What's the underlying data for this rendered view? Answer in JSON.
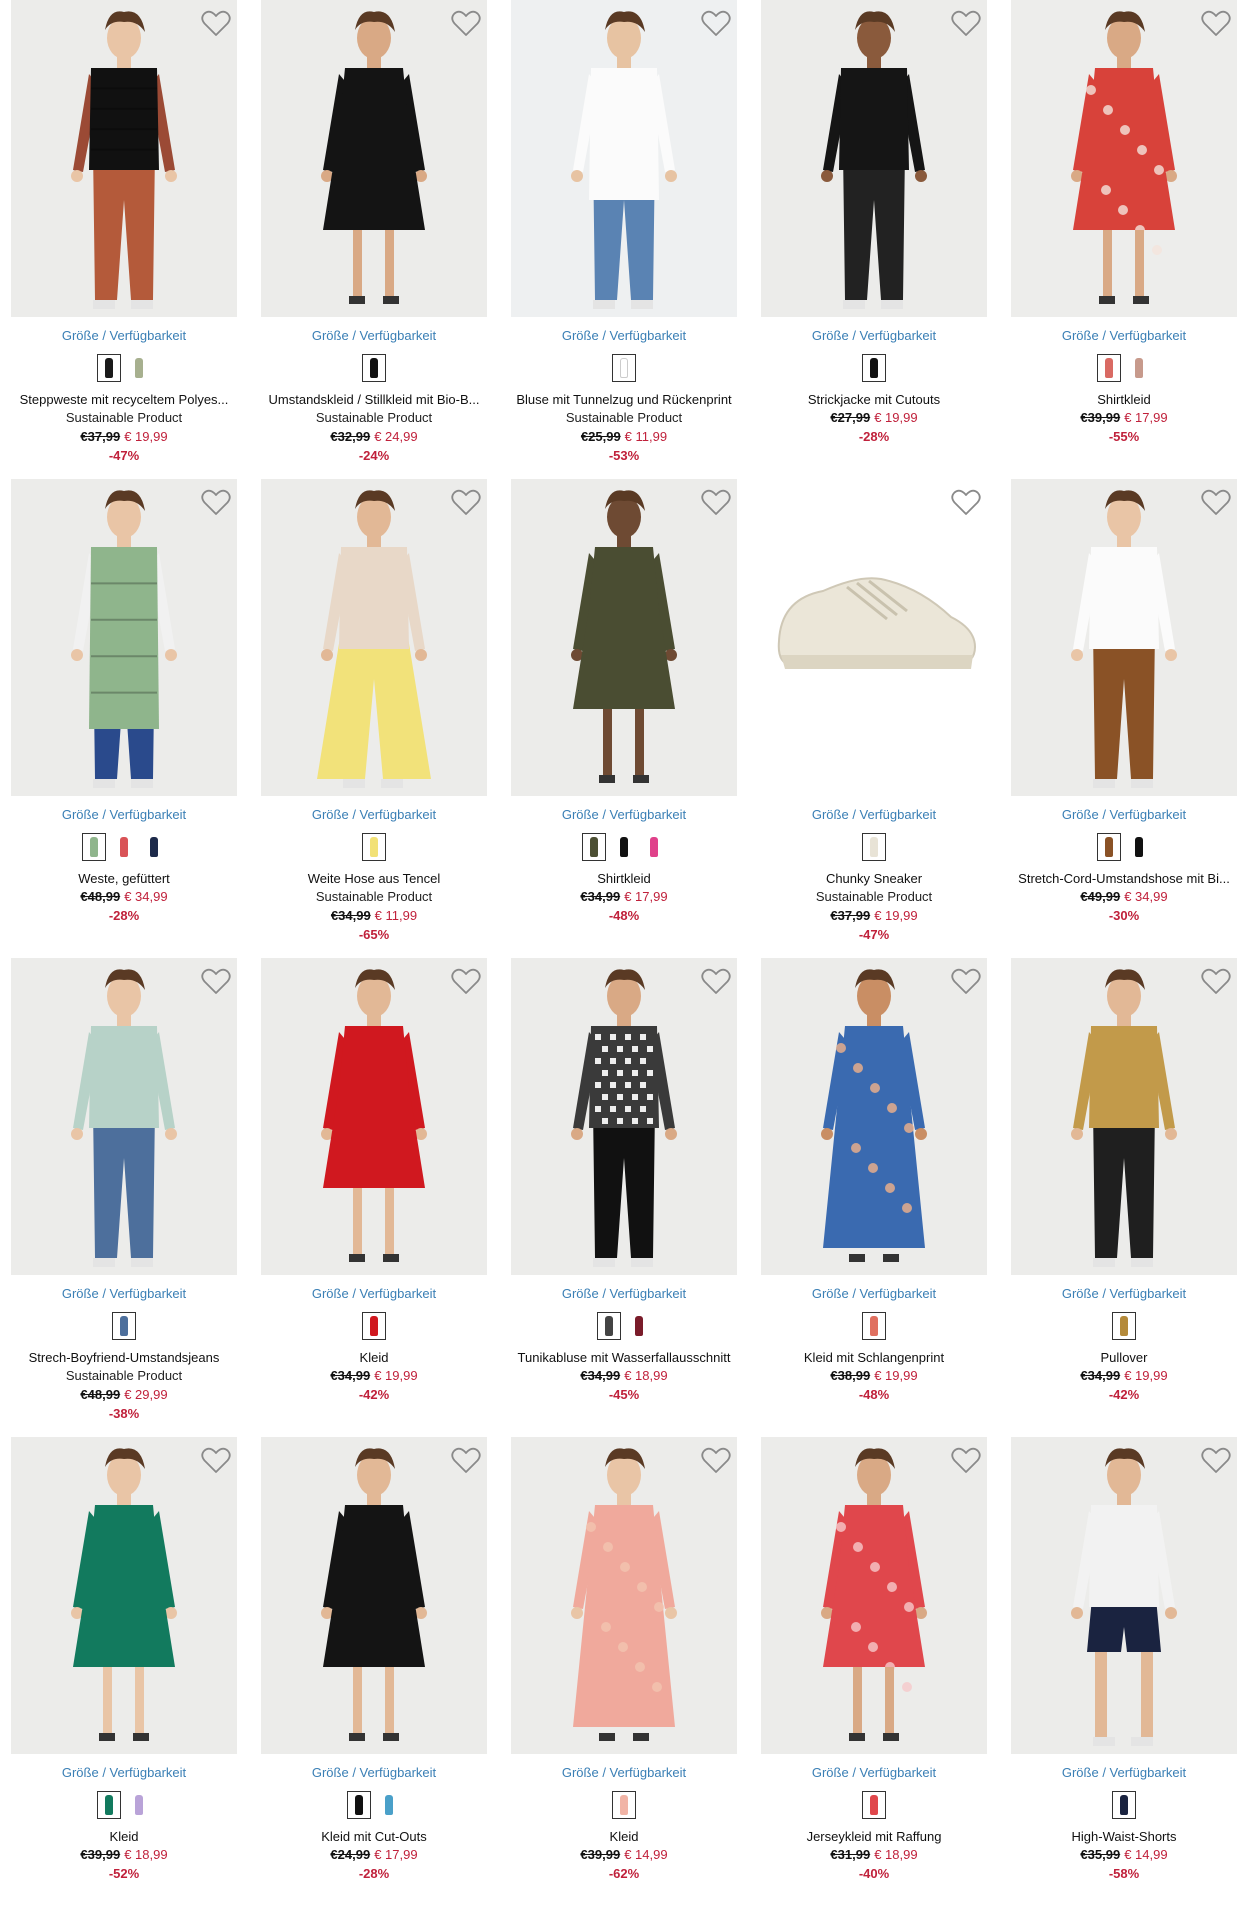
{
  "link_label": "Größe / Verfügbarkeit",
  "sustainable_label": "Sustainable Product",
  "products": [
    {
      "title": "Steppweste mit recyceltem Polyes...",
      "sub": "Sustainable Product",
      "old": "€37,99",
      "new": "€ 19,99",
      "disc": "-47%",
      "swatches": [
        "#1a1a1a",
        "#a7b08f"
      ],
      "look": "vest-black",
      "skin": "#e9c5a6",
      "bg": "#ececea"
    },
    {
      "title": "Umstandskleid / Stillkleid mit Bio-B...",
      "sub": "Sustainable Product",
      "old": "€32,99",
      "new": "€ 24,99",
      "disc": "-24%",
      "swatches": [
        "#111111"
      ],
      "look": "dress-black",
      "skin": "#d9a985",
      "bg": "#ececea"
    },
    {
      "title": "Bluse mit Tunnelzug und Rückenprint",
      "sub": "Sustainable Product",
      "old": "€25,99",
      "new": "€ 11,99",
      "disc": "-53%",
      "swatches": [
        "#ffffff"
      ],
      "look": "blouse-white",
      "skin": "#e7c3a2",
      "bg": "#eef0f1"
    },
    {
      "title": "Strickjacke mit Cutouts",
      "sub": "",
      "old": "€27,99",
      "new": "€ 19,99",
      "disc": "-28%",
      "swatches": [
        "#111111"
      ],
      "look": "cardigan-black",
      "skin": "#8a5a3c",
      "bg": "#ececea"
    },
    {
      "title": "Shirtkleid",
      "sub": "",
      "old": "€39,99",
      "new": "€ 17,99",
      "disc": "-55%",
      "swatches": [
        "#d96a63",
        "#c79a8c"
      ],
      "look": "dress-floral",
      "skin": "#d9a985",
      "bg": "#ededeb"
    },
    {
      "title": "Weste, gefüttert",
      "sub": "",
      "old": "€48,99",
      "new": "€ 34,99",
      "disc": "-28%",
      "swatches": [
        "#8fb58c",
        "#d95357",
        "#1d2a4a"
      ],
      "look": "vest-green",
      "skin": "#e9c5a6",
      "bg": "#ececea"
    },
    {
      "title": "Weite Hose aus Tencel",
      "sub": "Sustainable Product",
      "old": "€34,99",
      "new": "€ 11,99",
      "disc": "-65%",
      "swatches": [
        "#f2e176"
      ],
      "look": "pants-yellow",
      "skin": "#e2b896",
      "bg": "#ececea"
    },
    {
      "title": "Shirtkleid",
      "sub": "",
      "old": "€34,99",
      "new": "€ 17,99",
      "disc": "-48%",
      "swatches": [
        "#4c4f33",
        "#111111",
        "#e0418a"
      ],
      "look": "dress-olive",
      "skin": "#6e4a33",
      "bg": "#ececea"
    },
    {
      "title": "Chunky Sneaker",
      "sub": "Sustainable Product",
      "old": "€37,99",
      "new": "€ 19,99",
      "disc": "-47%",
      "swatches": [
        "#e8e3d6"
      ],
      "look": "sneaker",
      "skin": "#e8e3d6",
      "bg": "#ffffff"
    },
    {
      "title": "Stretch-Cord-Umstandshose mit Bi...",
      "sub": "",
      "old": "€49,99",
      "new": "€ 34,99",
      "disc": "-30%",
      "swatches": [
        "#8a5226",
        "#111111"
      ],
      "look": "pants-brown",
      "skin": "#e9c5a6",
      "bg": "#ececea"
    },
    {
      "title": "Strech-Boyfriend-Umstandsjeans",
      "sub": "Sustainable Product",
      "old": "€48,99",
      "new": "€ 29,99",
      "disc": "-38%",
      "swatches": [
        "#4d6f9c"
      ],
      "look": "jeans",
      "skin": "#e9c5a6",
      "bg": "#ececea"
    },
    {
      "title": "Kleid",
      "sub": "",
      "old": "€34,99",
      "new": "€ 19,99",
      "disc": "-42%",
      "swatches": [
        "#d0181f"
      ],
      "look": "dress-red",
      "skin": "#e2b896",
      "bg": "#ececea"
    },
    {
      "title": "Tunikabluse mit Wasserfallausschnitt",
      "sub": "",
      "old": "€34,99",
      "new": "€ 18,99",
      "disc": "-45%",
      "swatches": [
        "#444444",
        "#7a1c2a"
      ],
      "look": "blouse-pattern",
      "skin": "#d9a985",
      "bg": "#ececea"
    },
    {
      "title": "Kleid mit Schlangenprint",
      "sub": "",
      "old": "€38,99",
      "new": "€ 19,99",
      "disc": "-48%",
      "swatches": [
        "#e07060"
      ],
      "look": "dress-maxi",
      "skin": "#c98e64",
      "bg": "#ececea"
    },
    {
      "title": "Pullover",
      "sub": "",
      "old": "€34,99",
      "new": "€ 19,99",
      "disc": "-42%",
      "swatches": [
        "#b48a3a"
      ],
      "look": "sweater-gold",
      "skin": "#e2b896",
      "bg": "#ececea"
    },
    {
      "title": "Kleid",
      "sub": "",
      "old": "€39,99",
      "new": "€ 18,99",
      "disc": "-52%",
      "swatches": [
        "#127a5e",
        "#b9a3d8"
      ],
      "look": "dress-green",
      "skin": "#e9c5a6",
      "bg": "#ececea"
    },
    {
      "title": "Kleid mit Cut-Outs",
      "sub": "",
      "old": "€24,99",
      "new": "€ 17,99",
      "disc": "-28%",
      "swatches": [
        "#111111",
        "#4aa0c9"
      ],
      "look": "dress-lace",
      "skin": "#e2b896",
      "bg": "#ececea"
    },
    {
      "title": "Kleid",
      "sub": "",
      "old": "€39,99",
      "new": "€ 14,99",
      "disc": "-62%",
      "swatches": [
        "#f1b4a6"
      ],
      "look": "dress-block",
      "skin": "#e9c5a6",
      "bg": "#ececea"
    },
    {
      "title": "Jerseykleid mit Raffung",
      "sub": "",
      "old": "€31,99",
      "new": "€ 18,99",
      "disc": "-40%",
      "swatches": [
        "#e0474c"
      ],
      "look": "dress-pink",
      "skin": "#d9a985",
      "bg": "#ececea"
    },
    {
      "title": "High-Waist-Shorts",
      "sub": "",
      "old": "€35,99",
      "new": "€ 14,99",
      "disc": "-58%",
      "swatches": [
        "#1a2340"
      ],
      "look": "shorts",
      "skin": "#e2b896",
      "bg": "#ececea"
    }
  ]
}
